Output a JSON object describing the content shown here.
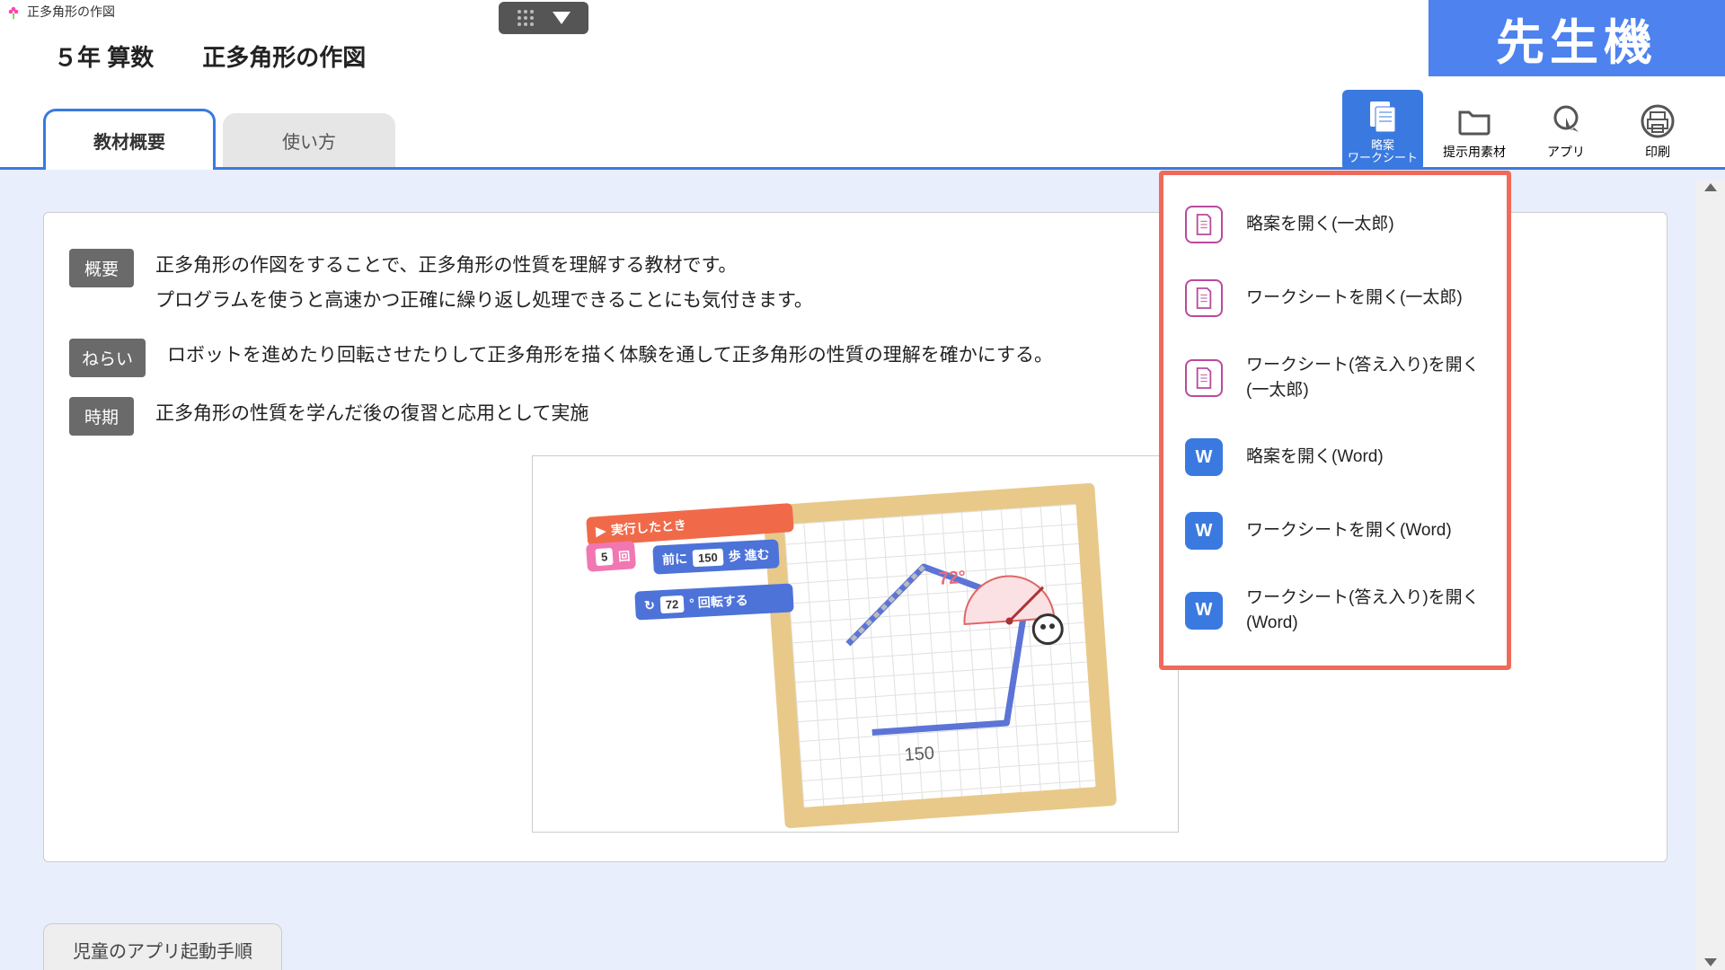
{
  "window": {
    "title": "正多角形の作図"
  },
  "breadcrumb": {
    "grade": "５年 算数",
    "unit": "正多角形の作図"
  },
  "badge": {
    "teacher": "先生機"
  },
  "tabs": {
    "active": "教材概要",
    "inactive": "使い方"
  },
  "toolbar": {
    "plan": "略案\nワークシート",
    "materials": "提示用素材",
    "apps": "アプリ",
    "print": "印刷"
  },
  "overview": {
    "summary_tag": "概要",
    "summary_line1": "正多角形の作図をすることで、正多角形の性質を理解する教材です。",
    "summary_line2": "プログラムを使うと高速かつ正確に繰り返し処理できることにも気付きます。",
    "aim_tag": "ねらい",
    "aim_text": "ロボットを進めたり回転させたりして正多角形を描く体験を通して正多角形の性質の理解を確かにする。",
    "timing_tag": "時期",
    "timing_text": "正多角形の性質を学んだ後の復習と応用として実施"
  },
  "illustration": {
    "run": "実行したとき",
    "repeat_n": "5",
    "repeat_unit": "回",
    "forward_pre": "前に",
    "forward_n": "150",
    "forward_unit": "歩 進む",
    "rotate_n": "72",
    "rotate_unit": "° 回転する",
    "angle": "72°",
    "length": "150"
  },
  "menu": {
    "items": [
      {
        "type": "ichitaro",
        "label": "略案を開く(一太郎)"
      },
      {
        "type": "ichitaro",
        "label": "ワークシートを開く(一太郎)"
      },
      {
        "type": "ichitaro",
        "label": "ワークシート(答え入り)を開く(一太郎)"
      },
      {
        "type": "word",
        "label": "略案を開く(Word)"
      },
      {
        "type": "word",
        "label": "ワークシートを開く(Word)"
      },
      {
        "type": "word",
        "label": "ワークシート(答え入り)を開く(Word)"
      }
    ]
  },
  "bottom": {
    "label": "児童のアプリ起動手順"
  }
}
